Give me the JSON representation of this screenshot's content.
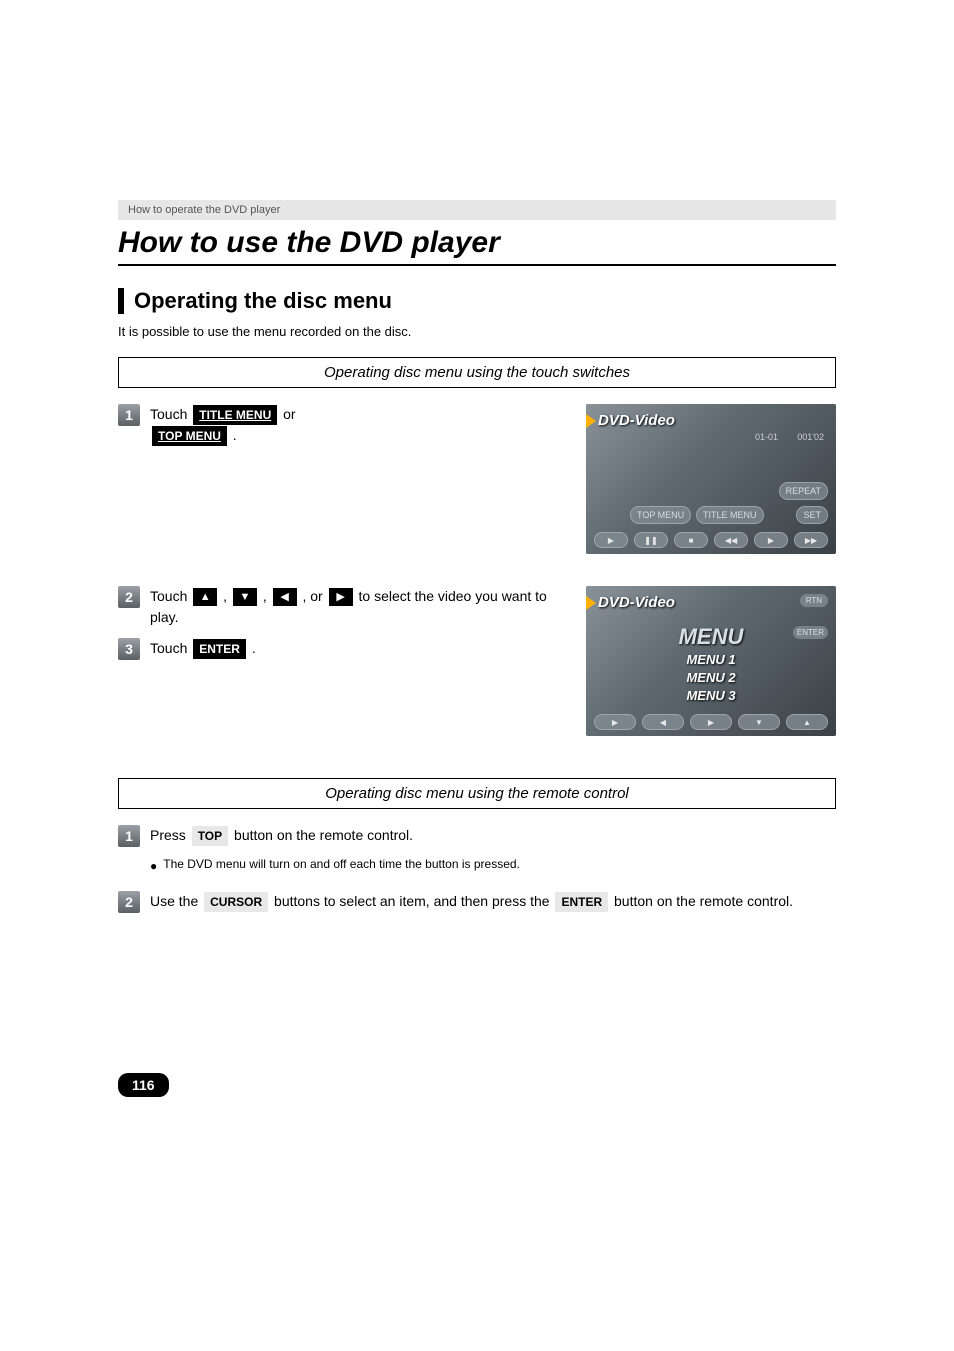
{
  "header": {
    "breadcrumb": "How to operate the DVD player"
  },
  "page_title": "How to use the DVD player",
  "section": {
    "title": "Operating the disc menu",
    "intro": "It is possible to use the menu recorded on the disc."
  },
  "touch_section": {
    "box_title": "Operating disc menu using the touch switches",
    "steps": {
      "1": {
        "pre": "Touch ",
        "btn1": "TITLE MENU",
        "mid": " or ",
        "btn2": "TOP MENU",
        "post": " ."
      },
      "2": {
        "pre": "Touch ",
        "mid1": " , ",
        "mid2": " , ",
        "mid3": " , or ",
        "post": " to select the video you want to play."
      },
      "3": {
        "pre": "Touch ",
        "btn": "ENTER",
        "post": " ."
      }
    }
  },
  "remote_section": {
    "box_title": "Operating disc menu using the remote control",
    "steps": {
      "1": {
        "pre": "Press ",
        "btn": "TOP",
        "post": " button on the remote control.",
        "bullet": "The DVD menu will turn on and off each time the button is pressed."
      },
      "2": {
        "pre": "Use the ",
        "btn1": "CURSOR",
        "mid": " buttons to select an item, and then press the ",
        "btn2": "ENTER",
        "post": " button on the remote control."
      }
    }
  },
  "screenshot1": {
    "title": "DVD-Video",
    "chapter": "01-01",
    "time": "001'02",
    "repeat": "REPEAT",
    "set": "SET",
    "topmenu": "TOP MENU",
    "titlemenu": "TITLE MENU",
    "ctrl1": "▶",
    "ctrl2": "❚❚",
    "ctrl3": "■",
    "ctrl4": "◀◀",
    "ctrl5": "▶",
    "ctrl6": "▶▶"
  },
  "screenshot2": {
    "title": "DVD-Video",
    "menu": "MENU",
    "item1": "MENU 1",
    "item2": "MENU 2",
    "item3": "MENU 3",
    "rtn": "RTN",
    "enter": "ENTER"
  },
  "page_number": "116"
}
